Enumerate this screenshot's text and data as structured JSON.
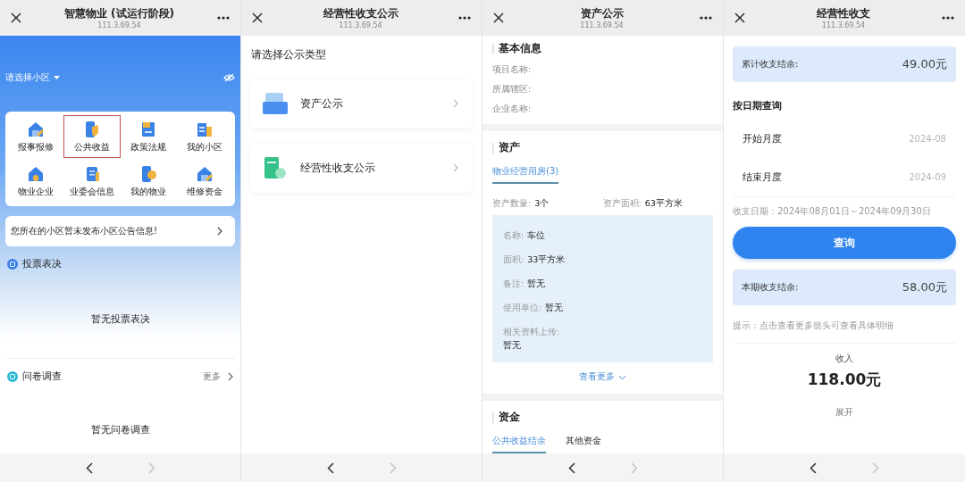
{
  "screens": [
    {
      "kind": "home",
      "title": "智慧物业 (试运行阶段)",
      "version": "111.3.69.54",
      "community": "请选择小区",
      "grid": [
        {
          "label": "报事报修",
          "selected": false
        },
        {
          "label": "公共收益",
          "selected": true
        },
        {
          "label": "政策法规",
          "selected": false
        },
        {
          "label": "我的小区",
          "selected": false
        },
        {
          "label": "物业企业",
          "selected": false
        },
        {
          "label": "业委会信息",
          "selected": false
        },
        {
          "label": "我的物业",
          "selected": false
        },
        {
          "label": "维修资金",
          "selected": false
        }
      ],
      "notice": "您所在的小区暂未发布小区公告信息!",
      "sections": [
        {
          "title": "投票表决",
          "empty": "暂无投票表决"
        },
        {
          "title": "问卷调查",
          "more": "更多",
          "empty": "暂无问卷调查"
        }
      ],
      "forward_enabled": false
    },
    {
      "kind": "menu",
      "title": "经营性收支公示",
      "version": "111.3.69.54",
      "prompt": "请选择公示类型",
      "items": [
        {
          "label": "资产公示"
        },
        {
          "label": "经营性收支公示"
        }
      ],
      "forward_enabled": false
    },
    {
      "kind": "assets",
      "title": "资产公示",
      "version": "111.3.69.54",
      "basic": {
        "title": "基本信息",
        "fields": [
          "项目名称:",
          "所属辖区:",
          "企业名称:"
        ]
      },
      "assets": {
        "title": "资产",
        "tabs": [
          {
            "label": "物业经营用房(3)",
            "selected": true
          }
        ],
        "summary": [
          {
            "label": "资产数量:",
            "value": "3个"
          },
          {
            "label": "资产面积:",
            "value": "63平方米"
          }
        ],
        "details": [
          {
            "label": "名称:",
            "value": "车位",
            "stacked": false
          },
          {
            "label": "面积:",
            "value": "33平方米",
            "stacked": false
          },
          {
            "label": "备注:",
            "value": "暂无",
            "stacked": false
          },
          {
            "label": "使用单位:",
            "value": "暂无",
            "stacked": false
          },
          {
            "label": "相关资料上传:",
            "value": "暂无",
            "stacked": true
          }
        ],
        "more": "查看更多"
      },
      "funds": {
        "title": "资金",
        "tabs": [
          {
            "label": "公共收益结余",
            "selected": true
          },
          {
            "label": "其他资金",
            "selected": false
          }
        ]
      },
      "forward_enabled": false
    },
    {
      "kind": "finance",
      "title": "经营性收支",
      "version": "111.3.69.54",
      "total": {
        "label": "累计收支结余:",
        "value": "49.00元"
      },
      "query_title": "按日期查询",
      "months": [
        {
          "label": "开始月度",
          "value": "2024-08"
        },
        {
          "label": "结束月度",
          "value": "2024-09"
        }
      ],
      "range": "收支日期：2024年08月01日～2024年09月30日",
      "button": "查询",
      "period": {
        "label": "本期收支结余:",
        "value": "58.00元"
      },
      "hint": "提示：点击查看更多箭头可查看具体明细",
      "income": {
        "label": "收入",
        "value": "118.00元",
        "expand": "展开"
      },
      "forward_enabled": false
    }
  ]
}
